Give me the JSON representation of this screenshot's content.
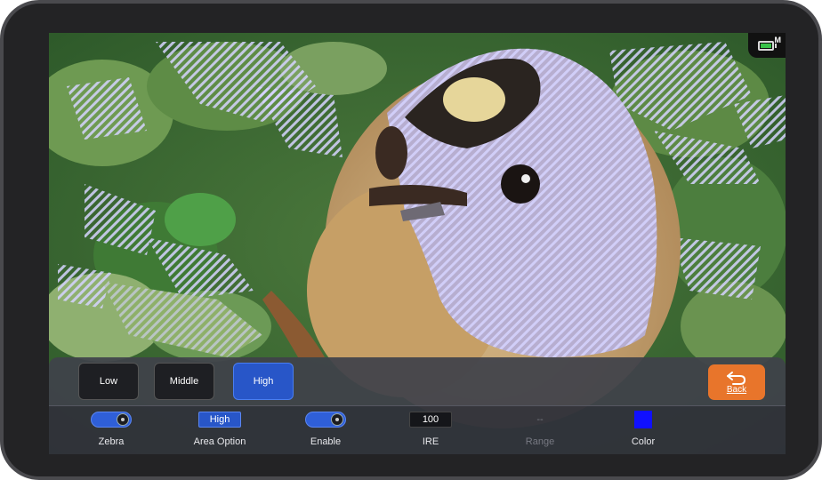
{
  "status": {
    "battery_mode": "M",
    "battery_color": "#39c24a"
  },
  "levels": [
    {
      "label": "Low",
      "active": false
    },
    {
      "label": "Middle",
      "active": false
    },
    {
      "label": "High",
      "active": true
    }
  ],
  "back": {
    "label": "Back",
    "icon": "return-arrow-icon",
    "color": "#e8752b"
  },
  "controls": {
    "zebra": {
      "label": "Zebra",
      "state": "on"
    },
    "area_option": {
      "label": "Area Option",
      "value": "High"
    },
    "enable": {
      "label": "Enable",
      "state": "on"
    },
    "ire": {
      "label": "IRE",
      "value": "100"
    },
    "range": {
      "label": "Range",
      "value": "--"
    },
    "color": {
      "label": "Color",
      "value": "#1010ff"
    }
  },
  "colors": {
    "accent": "#2856c8",
    "zebra_stripe": "#c8c8ff"
  }
}
